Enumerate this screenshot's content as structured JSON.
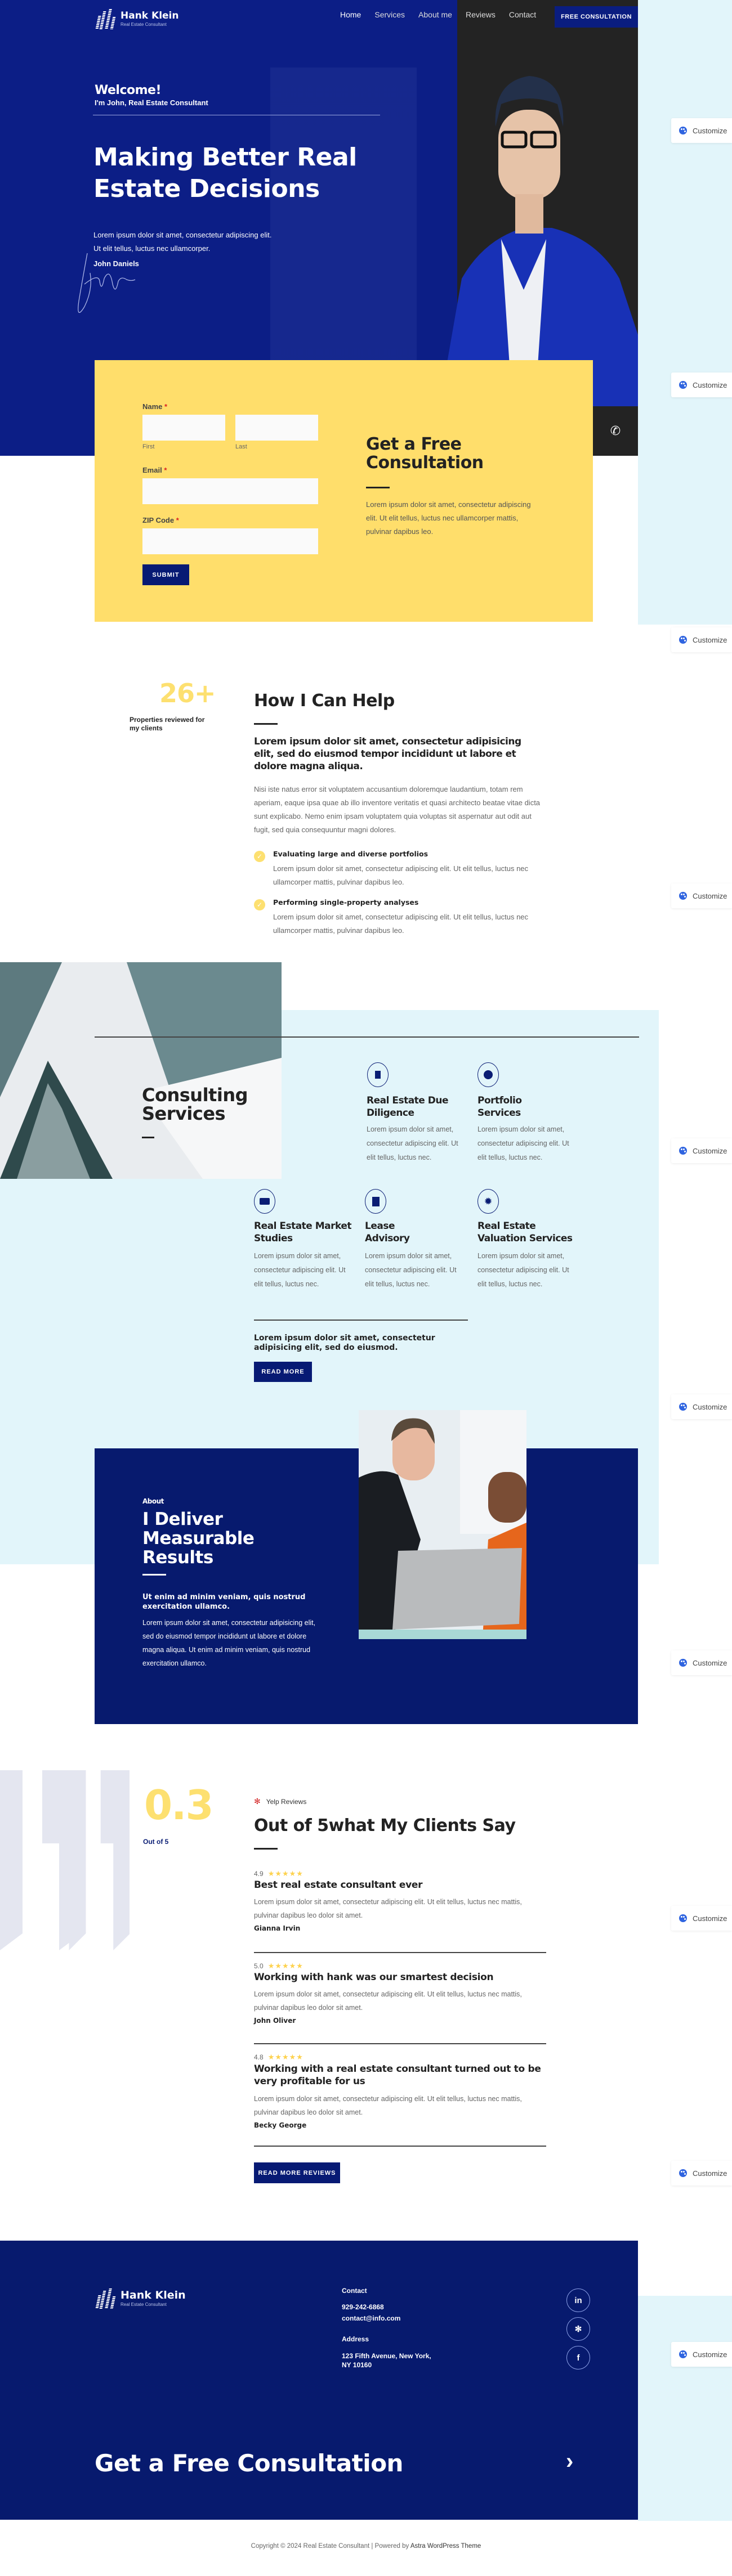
{
  "header": {
    "brand_name": "Hank Klein",
    "brand_tagline": "Real Estate Consultant",
    "nav": [
      "Home",
      "Services",
      "About me",
      "Reviews",
      "Contact"
    ],
    "cta": "FREE CONSULTATION"
  },
  "hero": {
    "welcome": "Welcome!",
    "intro": "I'm John, Real Estate Consultant",
    "title_line1": "Making Better Real",
    "title_line2": "Estate Decisions",
    "text_line1": "Lorem ipsum dolor sit amet, consectetur adipiscing elit.",
    "text_line2": "Ut elit tellus, luctus nec ullamcorper.",
    "signature_name": "John Daniels"
  },
  "consultation_form": {
    "name_label": "Name",
    "first_label": "First",
    "last_label": "Last",
    "email_label": "Email",
    "zip_label": "ZIP Code",
    "required_mark": "*",
    "first_value": "",
    "last_value": "",
    "email_value": "",
    "zip_value": "",
    "submit": "SUBMIT",
    "heading_line1": "Get a Free",
    "heading_line2": "Consultation",
    "text": "Lorem ipsum dolor sit amet, consectetur adipiscing elit. Ut elit tellus, luctus nec ullamcorper mattis, pulvinar dapibus leo."
  },
  "customize_label": "Customize",
  "help": {
    "stat_value": "26+",
    "stat_label": "Properties reviewed for my clients",
    "heading": "How I Can Help",
    "lead": "Lorem ipsum dolor sit amet, consectetur adipisicing elit, sed do eiusmod tempor incididunt ut labore et dolore magna aliqua.",
    "body": "Nisi iste natus error sit voluptatem accusantium doloremque laudantium, totam rem aperiam, eaque ipsa quae ab illo inventore veritatis et quasi architecto beatae vitae dicta sunt explicabo. Nemo enim ipsam voluptatem quia voluptas sit aspernatur aut odit aut fugit, sed quia consequuntur magni dolores.",
    "items": [
      {
        "title": "Evaluating large and diverse portfolios",
        "text": "Lorem ipsum dolor sit amet, consectetur adipiscing elit. Ut elit tellus, luctus nec ullamcorper mattis, pulvinar dapibus leo."
      },
      {
        "title": "Performing single-property analyses",
        "text": "Lorem ipsum dolor sit amet, consectetur adipiscing elit. Ut elit tellus, luctus nec ullamcorper mattis, pulvinar dapibus leo."
      }
    ]
  },
  "services": {
    "heading_line1": "Consulting",
    "heading_line2": "Services",
    "items": [
      {
        "icon": "building-icon",
        "title_line1": "Real Estate Due",
        "title_line2": "Diligence",
        "text": "Lorem ipsum dolor sit amet, consectetur adipiscing elit. Ut elit tellus, luctus nec."
      },
      {
        "icon": "portfolio-icon",
        "title_line1": "Portfolio",
        "title_line2": "Services",
        "text": "Lorem ipsum dolor sit amet, consectetur adipiscing elit. Ut elit tellus, luctus nec."
      },
      {
        "icon": "briefcase-icon",
        "title_line1": "Real Estate Market",
        "title_line2": "Studies",
        "text": "Lorem ipsum dolor sit amet, consectetur adipiscing elit. Ut elit tellus, luctus nec."
      },
      {
        "icon": "document-sign-icon",
        "title_line1": "Lease",
        "title_line2": "Advisory",
        "text": "Lorem ipsum dolor sit amet, consectetur adipiscing elit. Ut elit tellus, luctus nec."
      },
      {
        "icon": "certificate-icon",
        "title_line1": "Real Estate",
        "title_line2": "Valuation Services",
        "text": "Lorem ipsum dolor sit amet, consectetur adipiscing elit. Ut elit tellus, luctus nec."
      }
    ],
    "footer_text": "Lorem ipsum dolor sit amet, consectetur adipisicing elit, sed do eiusmod.",
    "read_more": "READ MORE"
  },
  "about": {
    "label": "About",
    "heading_line1": "I Deliver",
    "heading_line2": "Measurable",
    "heading_line3": "Results",
    "lead": "Ut enim ad minim veniam, quis nostrud exercitation ullamco.",
    "body": "Lorem ipsum dolor sit amet, consectetur adipisicing elit, sed do eiusmod tempor incididunt ut labore et dolore magna aliqua. Ut enim ad minim veniam, quis nostrud exercitation ullamco."
  },
  "reviews": {
    "score": "0.3",
    "score_label": "Out of 5",
    "source": "Yelp Reviews",
    "heading": "Out of 5what My Clients Say",
    "items": [
      {
        "rating": "4.9",
        "stars": "★★★★★",
        "title": "Best real estate consultant ever",
        "text": "Lorem ipsum dolor sit amet, consectetur adipiscing elit. Ut elit tellus, luctus nec mattis, pulvinar dapibus leo dolor sit amet.",
        "author": "Gianna Irvin"
      },
      {
        "rating": "5.0",
        "stars": "★★★★★",
        "title": "Working with hank was our smartest decision",
        "text": "Lorem ipsum dolor sit amet, consectetur adipiscing elit. Ut elit tellus, luctus nec mattis, pulvinar dapibus leo dolor sit amet.",
        "author": "John Oliver"
      },
      {
        "rating": "4.8",
        "stars": "★★★★★",
        "title": "Working with a real estate consultant turned out to be very profitable for us",
        "text": "Lorem ipsum dolor sit amet, consectetur adipiscing elit. Ut elit tellus, luctus nec mattis, pulvinar dapibus leo dolor sit amet.",
        "author": "Becky George"
      }
    ],
    "read_more": "READ MORE REVIEWS"
  },
  "footer": {
    "brand_name": "Hank Klein",
    "brand_tagline": "Real Estate Consultant",
    "contact_heading": "Contact",
    "phone": "929-242-6868",
    "email": "contact@info.com",
    "address_heading": "Address",
    "address_line1": "123 Fifth Avenue, New York,",
    "address_line2": "NY 10160",
    "social": [
      "linkedin-icon",
      "yelp-icon",
      "facebook-icon"
    ],
    "cta": "Get a Free Consultation",
    "copyright": "Copyright © 2024 Real Estate Consultant | Powered by ",
    "theme_link": "Astra WordPress Theme"
  },
  "colors": {
    "navy": "#0a1d80",
    "yellow": "#ffde6b",
    "light_blue": "#e2f5fa",
    "dark": "#232323"
  }
}
